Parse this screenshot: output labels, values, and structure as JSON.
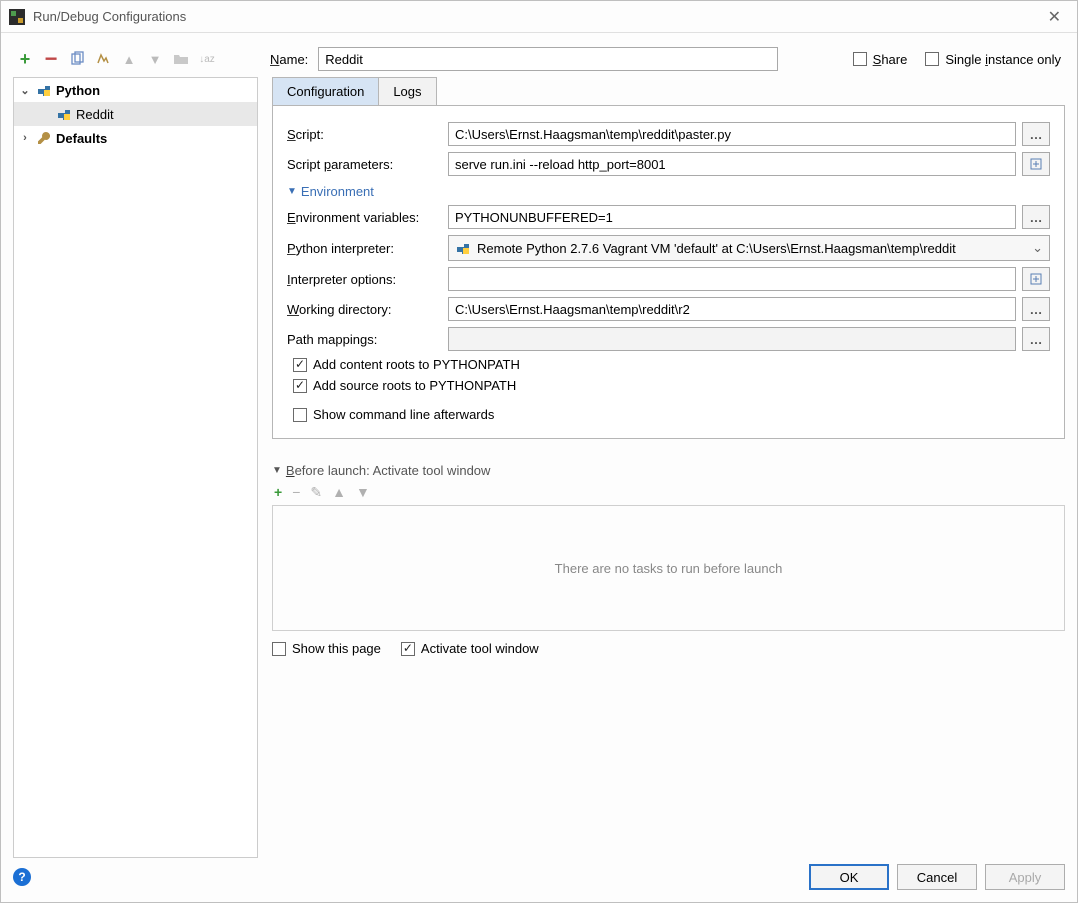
{
  "window": {
    "title": "Run/Debug Configurations"
  },
  "top": {
    "name_label": "Name:",
    "name_value": "Reddit",
    "share_label": "Share",
    "single_instance_label": "Single instance only"
  },
  "tree": {
    "python": {
      "label": "Python"
    },
    "reddit": {
      "label": "Reddit"
    },
    "defaults": {
      "label": "Defaults"
    }
  },
  "tabs": {
    "config": "Configuration",
    "logs": "Logs"
  },
  "config": {
    "script_label": "Script:",
    "script_value": "C:\\Users\\Ernst.Haagsman\\temp\\reddit\\paster.py",
    "params_label": "Script parameters:",
    "params_value": "serve run.ini --reload http_port=8001",
    "env_section": "Environment",
    "envvars_label": "Environment variables:",
    "envvars_value": "PYTHONUNBUFFERED=1",
    "interp_label": "Python interpreter:",
    "interp_value": "Remote Python 2.7.6 Vagrant VM 'default' at C:\\Users\\Ernst.Haagsman\\temp\\reddit",
    "interp_opts_label": "Interpreter options:",
    "interp_opts_value": "",
    "workdir_label": "Working directory:",
    "workdir_value": "C:\\Users\\Ernst.Haagsman\\temp\\reddit\\r2",
    "pathmap_label": "Path mappings:",
    "pathmap_value": "",
    "add_content_roots": "Add content roots to PYTHONPATH",
    "add_source_roots": "Add source roots to PYTHONPATH",
    "show_cmdline": "Show command line afterwards"
  },
  "before": {
    "section": "Before launch: Activate tool window",
    "empty": "There are no tasks to run before launch",
    "show_this_page": "Show this page",
    "activate_tool": "Activate tool window"
  },
  "footer": {
    "ok": "OK",
    "cancel": "Cancel",
    "apply": "Apply"
  }
}
